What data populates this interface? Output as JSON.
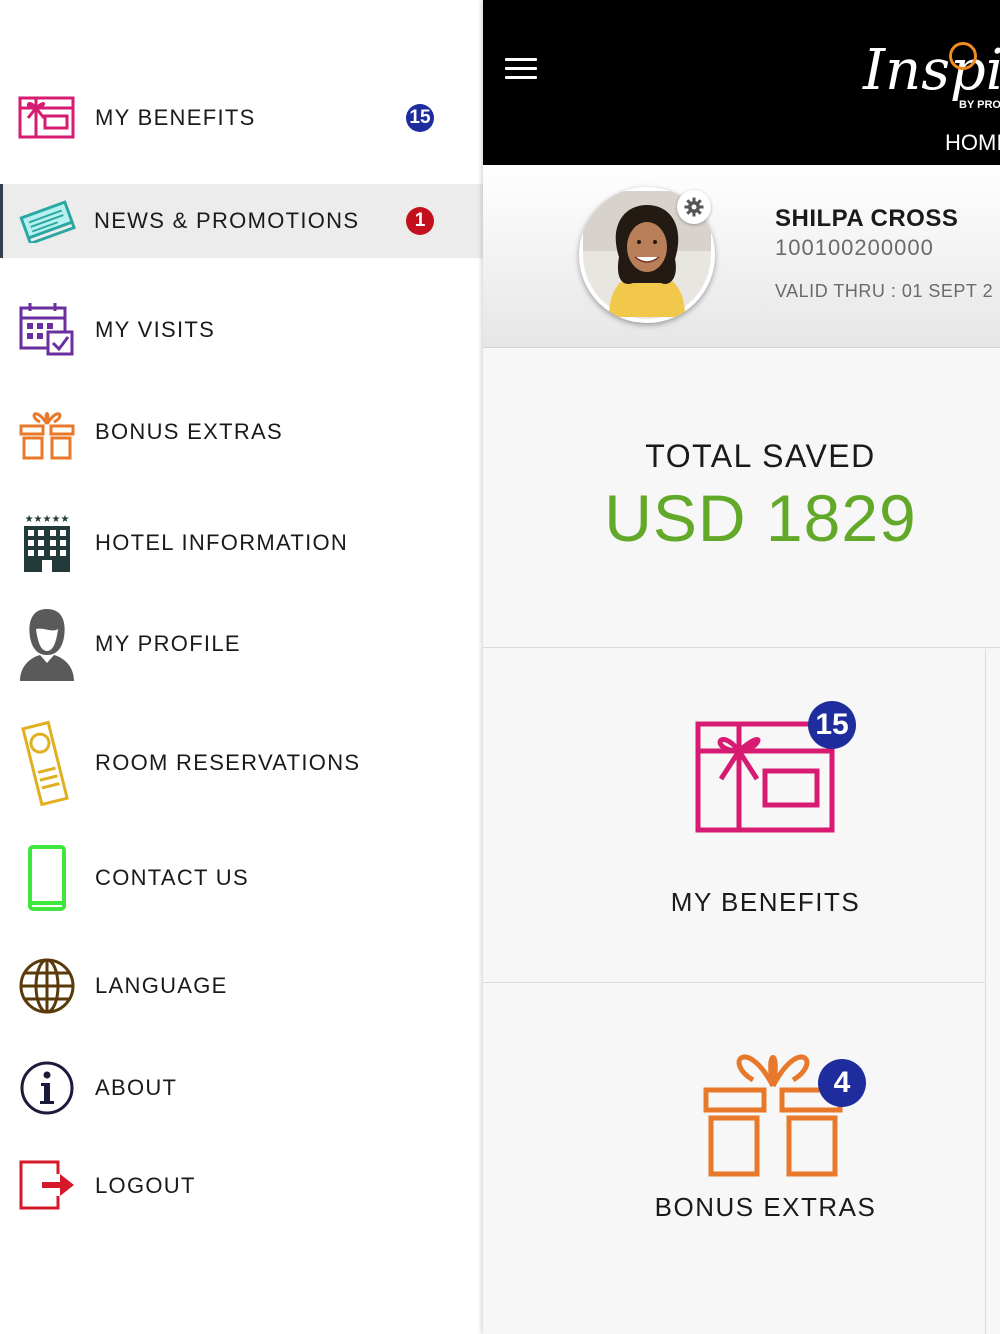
{
  "colors": {
    "accent_green": "#62a92a",
    "badge_blue": "#1f2c9e",
    "badge_red": "#c4101c",
    "benefits_pink": "#d81b72",
    "extras_orange": "#e8782a"
  },
  "menu": {
    "items": [
      {
        "label": "MY BENEFITS",
        "icon": "gift-card-icon",
        "badge": "15"
      },
      {
        "label": "NEWS & PROMOTIONS",
        "icon": "newspaper-icon",
        "badge": "1",
        "active": true
      },
      {
        "label": "MY VISITS",
        "icon": "calendar-check-icon"
      },
      {
        "label": "BONUS EXTRAS",
        "icon": "gift-box-icon"
      },
      {
        "label": "HOTEL INFORMATION",
        "icon": "hotel-building-icon"
      },
      {
        "label": "MY PROFILE",
        "icon": "user-silhouette-icon"
      },
      {
        "label": "ROOM RESERVATIONS",
        "icon": "door-hanger-icon"
      },
      {
        "label": "CONTACT US",
        "icon": "mobile-phone-icon"
      },
      {
        "label": "LANGUAGE",
        "icon": "globe-icon"
      },
      {
        "label": "ABOUT",
        "icon": "info-icon"
      },
      {
        "label": "LOGOUT",
        "icon": "logout-icon"
      }
    ]
  },
  "header": {
    "brand": "Inspira",
    "brand_sub": "BY PRO",
    "nav_label": "HOMI"
  },
  "profile": {
    "name": "SHILPA CROSS",
    "member_id": "100100200000",
    "valid_thru": "VALID THRU : 01 SEPT 2"
  },
  "savings": {
    "label": "TOTAL SAVED",
    "value": "USD 1829"
  },
  "tiles": {
    "benefits": {
      "label": "MY BENEFITS",
      "badge": "15"
    },
    "extras": {
      "label": "BONUS EXTRAS",
      "badge": "4"
    }
  }
}
